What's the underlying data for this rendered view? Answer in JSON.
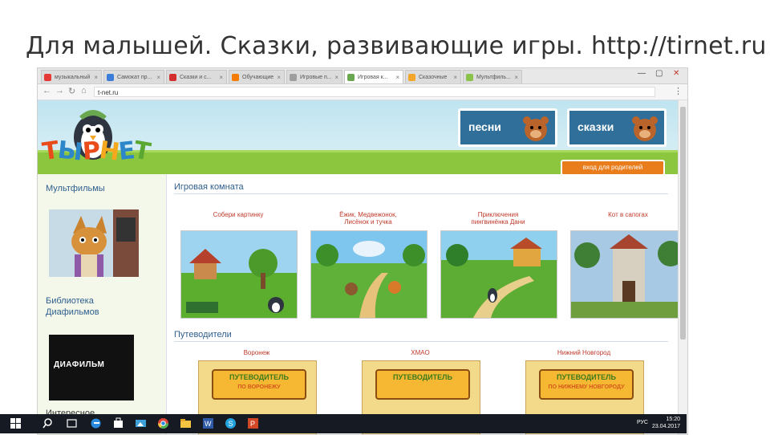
{
  "slide": {
    "title": "Для малышей. Сказки, развивающие игры. http://tirnet.ru"
  },
  "browser": {
    "tabs": [
      {
        "label": "музыкальный",
        "favicon_color": "#e53935"
      },
      {
        "label": "Самокат пр...",
        "favicon_color": "#3b7dd8"
      },
      {
        "label": "Сказки и с...",
        "favicon_color": "#d32f2f"
      },
      {
        "label": "Обучающие",
        "favicon_color": "#f57c00"
      },
      {
        "label": "Игровые п...",
        "favicon_color": "#9e9e9e"
      },
      {
        "label": "Игровая к...",
        "favicon_color": "#6aa84f"
      },
      {
        "label": "Сказочные",
        "favicon_color": "#f4a62a"
      },
      {
        "label": "Мультфиль...",
        "favicon_color": "#8bc34a"
      }
    ],
    "url": "t-net.ru",
    "window_controls": {
      "minimize": "—",
      "maximize": "▢",
      "close": "✕"
    },
    "menu": "⋮"
  },
  "site": {
    "logo_letters": [
      "Т",
      "Ы",
      "Р",
      "Н",
      "Е",
      "Т"
    ],
    "logo_colors": [
      "#e94b1b",
      "#2d86c8",
      "#e94b1b",
      "#f6a91c",
      "#2d86c8",
      "#5aa832"
    ],
    "cards": [
      {
        "label": "песни"
      },
      {
        "label": "сказки"
      }
    ],
    "parent_button": "вход для родителей"
  },
  "sidebar": {
    "cartoons": "Мультфильмы",
    "library_line1": "Библиотека",
    "library_line2": "Диафильмов",
    "dia_logo": "ДИАФИЛЬМ",
    "interesting": "Интересное"
  },
  "main": {
    "playroom_title": "Игровая комната",
    "games": [
      {
        "line1": "Собери картинку",
        "line2": ""
      },
      {
        "line1": "Ёжик, Медвежонок,",
        "line2": "Лисёнок и тучка"
      },
      {
        "line1": "Приключения",
        "line2": "пингвинёнка Дани"
      },
      {
        "line1": "Кот в сапогах",
        "line2": ""
      }
    ],
    "guides_title": "Путеводители",
    "guides": [
      {
        "city": "Воронеж",
        "banner": "ПУТЕВОДИТЕЛЬ",
        "sub": "ПО ВОРОНЕЖУ"
      },
      {
        "city": "ХМАО",
        "banner": "ПУТЕВОДИТЕЛЬ",
        "sub": ""
      },
      {
        "city": "Нижний Новгород",
        "banner": "ПУТЕВОДИТЕЛЬ",
        "sub": "ПО НИЖНЕМУ НОВГОРОДУ"
      }
    ]
  },
  "taskbar": {
    "lang": "РУС",
    "time": "15:20",
    "date": "23.04.2017",
    "apps": [
      {
        "name": "windows-start",
        "color": "#ffffff"
      },
      {
        "name": "search",
        "color": "#ffffff"
      },
      {
        "name": "task-view",
        "color": "#ffffff"
      },
      {
        "name": "edge",
        "color": "#2b8be0"
      },
      {
        "name": "store",
        "color": "#ffffff"
      },
      {
        "name": "photos",
        "color": "#3ea0d9"
      },
      {
        "name": "chrome",
        "color": "#e0453a"
      },
      {
        "name": "explorer",
        "color": "#f4c542"
      },
      {
        "name": "word",
        "color": "#2f5aa8"
      },
      {
        "name": "skype",
        "color": "#22a3e0"
      },
      {
        "name": "powerpoint",
        "color": "#d24726"
      }
    ]
  }
}
